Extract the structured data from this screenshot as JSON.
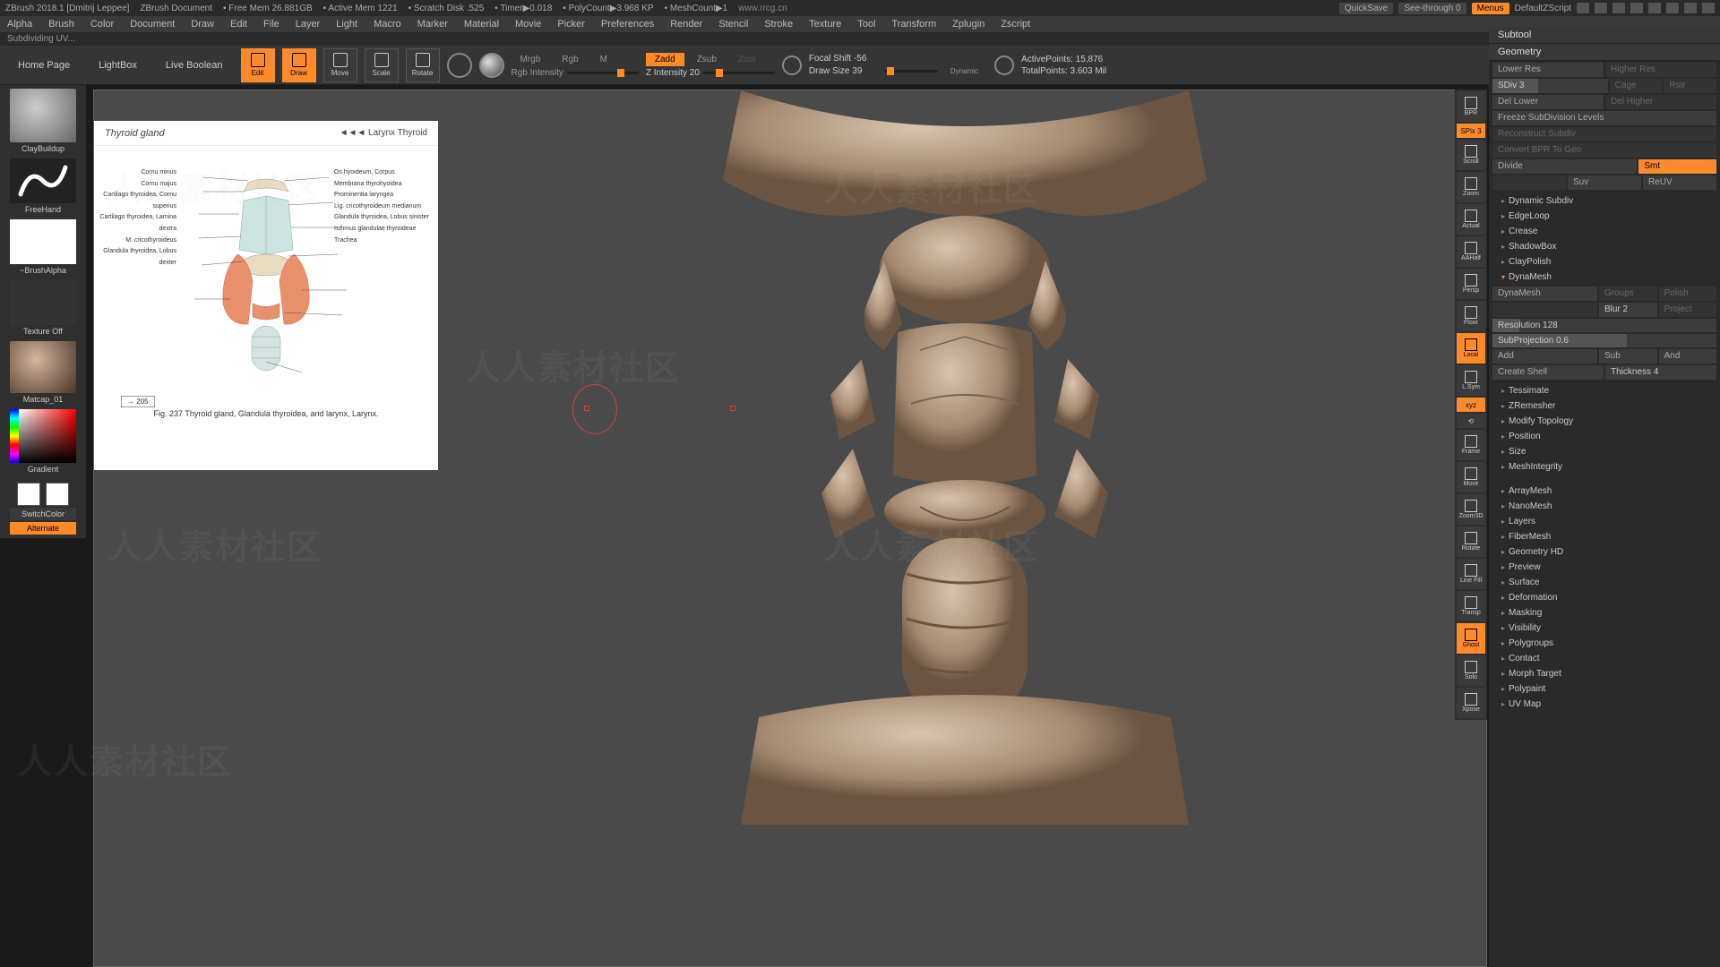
{
  "title": {
    "app": "ZBrush 2018.1 [Dmitrij Leppee]",
    "doc": "ZBrush Document",
    "freemem": "• Free Mem 26.881GB",
    "activemem": "• Active Mem 1221",
    "scratch": "• Scratch Disk .525",
    "timer": "• Timer▶0.018",
    "poly": "• PolyCount▶3.968 KP",
    "mesh": "• MeshCount▶1",
    "url": "www.rrcg.cn",
    "quicksave": "QuickSave",
    "seethrough": "See-through  0",
    "menus": "Menus",
    "zscript": "DefaultZScript"
  },
  "menu": [
    "Alpha",
    "Brush",
    "Color",
    "Document",
    "Draw",
    "Edit",
    "File",
    "Layer",
    "Light",
    "Macro",
    "Marker",
    "Material",
    "Movie",
    "Picker",
    "Preferences",
    "Render",
    "Stencil",
    "Stroke",
    "Texture",
    "Tool",
    "Transform",
    "Zplugin",
    "Zscript"
  ],
  "status": "Subdividing UV...",
  "tabs": {
    "home": "Home Page",
    "lightbox": "LightBox",
    "livebool": "Live Boolean"
  },
  "modes": {
    "edit": "Edit",
    "draw": "Draw",
    "move": "Move",
    "scale": "Scale",
    "rotate": "Rotate"
  },
  "rgb": {
    "mrgb": "Mrgb",
    "rgb": "Rgb",
    "m": "M",
    "intensity": "Rgb Intensity"
  },
  "z": {
    "zadd": "Zadd",
    "zsub": "Zsub",
    "zcut": "Zcut",
    "intensity": "Z Intensity 20"
  },
  "focal": {
    "shift": "Focal Shift -56",
    "size": "Draw Size  39",
    "dynamic": "Dynamic"
  },
  "stats": {
    "active": "ActivePoints: 15,876",
    "total": "TotalPoints: 3.603 Mil"
  },
  "left": {
    "brush": "ClayBuildup",
    "stroke": "FreeHand",
    "alpha": "~BrushAlpha",
    "texture": "Texture Off",
    "material": "Matcap_01",
    "gradient": "Gradient",
    "switch": "SwitchColor",
    "alternate": "Alternate"
  },
  "ref": {
    "title": "Thyroid gland",
    "arrows": "◄◄◄    Larynx    Thyroid",
    "caption": "Fig. 237   Thyroid gland, Glandula thyroidea, and larynx, Larynx.",
    "labels": [
      "Cornu minus",
      "Os hyoideum, Corpus",
      "Cornu majus",
      "Membrana thyrohyoidea",
      "Cartilago thyroidea, Cornu superius",
      "Prominentia laryngea",
      "Cartilago thyroidea, Lamina dextra",
      "Lig. cricothyroideum medianum",
      "M. cricothyroideus",
      "Glandula thyroidea, Lobus sinister",
      "Glandula thyroidea, Lobus dexter",
      "Isthmus glandulae thyroideae",
      "Trachea"
    ],
    "pagebtn": "→ 205"
  },
  "righttools": [
    "BPR",
    "SPix 3",
    "Scroll",
    "Zoom",
    "Actual",
    "AAHalf",
    "Persp",
    "Floor",
    "Local",
    "L.Sym",
    "xyz",
    "",
    "Frame",
    "Move",
    "Zoom3D",
    "Rotate",
    "Line Fill",
    "Transp",
    "Ghost",
    "Solo",
    "Xpose"
  ],
  "panel": {
    "subtool": "Subtool",
    "geometry": "Geometry",
    "lowerres": "Lower Res",
    "higherres": "Higher Res",
    "sdiv": "SDiv 3",
    "cage": "Cage",
    "rstr": "Rstr",
    "dellower": "Del Lower",
    "delhigher": "Del Higher",
    "freeze": "Freeze SubDivision Levels",
    "reconstruct": "Reconstruct Subdiv",
    "convertbpr": "Convert BPR To Geo",
    "divide": "Divide",
    "smt": "Smt",
    "suv": "Suv",
    "reuv": "ReUV",
    "dynamicsub": "Dynamic Subdiv",
    "edgeloop": "EdgeLoop",
    "crease": "Crease",
    "shadowbox": "ShadowBox",
    "claypolish": "ClayPolish",
    "dynamesh": "DynaMesh",
    "dynameshbtn": "DynaMesh",
    "groups": "Groups",
    "polish": "Polish",
    "blur": "Blur 2",
    "project": "Project",
    "resolution": "Resolution 128",
    "subprojection": "SubProjection 0.6",
    "add": "Add",
    "sub": "Sub",
    "and": "And",
    "createshell": "Create Shell",
    "thickness": "Thickness 4",
    "tessimate": "Tessimate",
    "zremesher": "ZRemesher",
    "modifytopo": "Modify Topology",
    "position": "Position",
    "size": "Size",
    "meshintegrity": "MeshIntegrity",
    "arraymesh": "ArrayMesh",
    "nanomesh": "NanoMesh",
    "layers": "Layers",
    "fibermesh": "FiberMesh",
    "geometryhd": "Geometry HD",
    "preview": "Preview",
    "surface": "Surface",
    "deformation": "Deformation",
    "masking": "Masking",
    "visibility": "Visibility",
    "polygroups": "Polygroups",
    "contact": "Contact",
    "morphtarget": "Morph Target",
    "polypaint": "Polypaint",
    "uvmap": "UV Map"
  }
}
